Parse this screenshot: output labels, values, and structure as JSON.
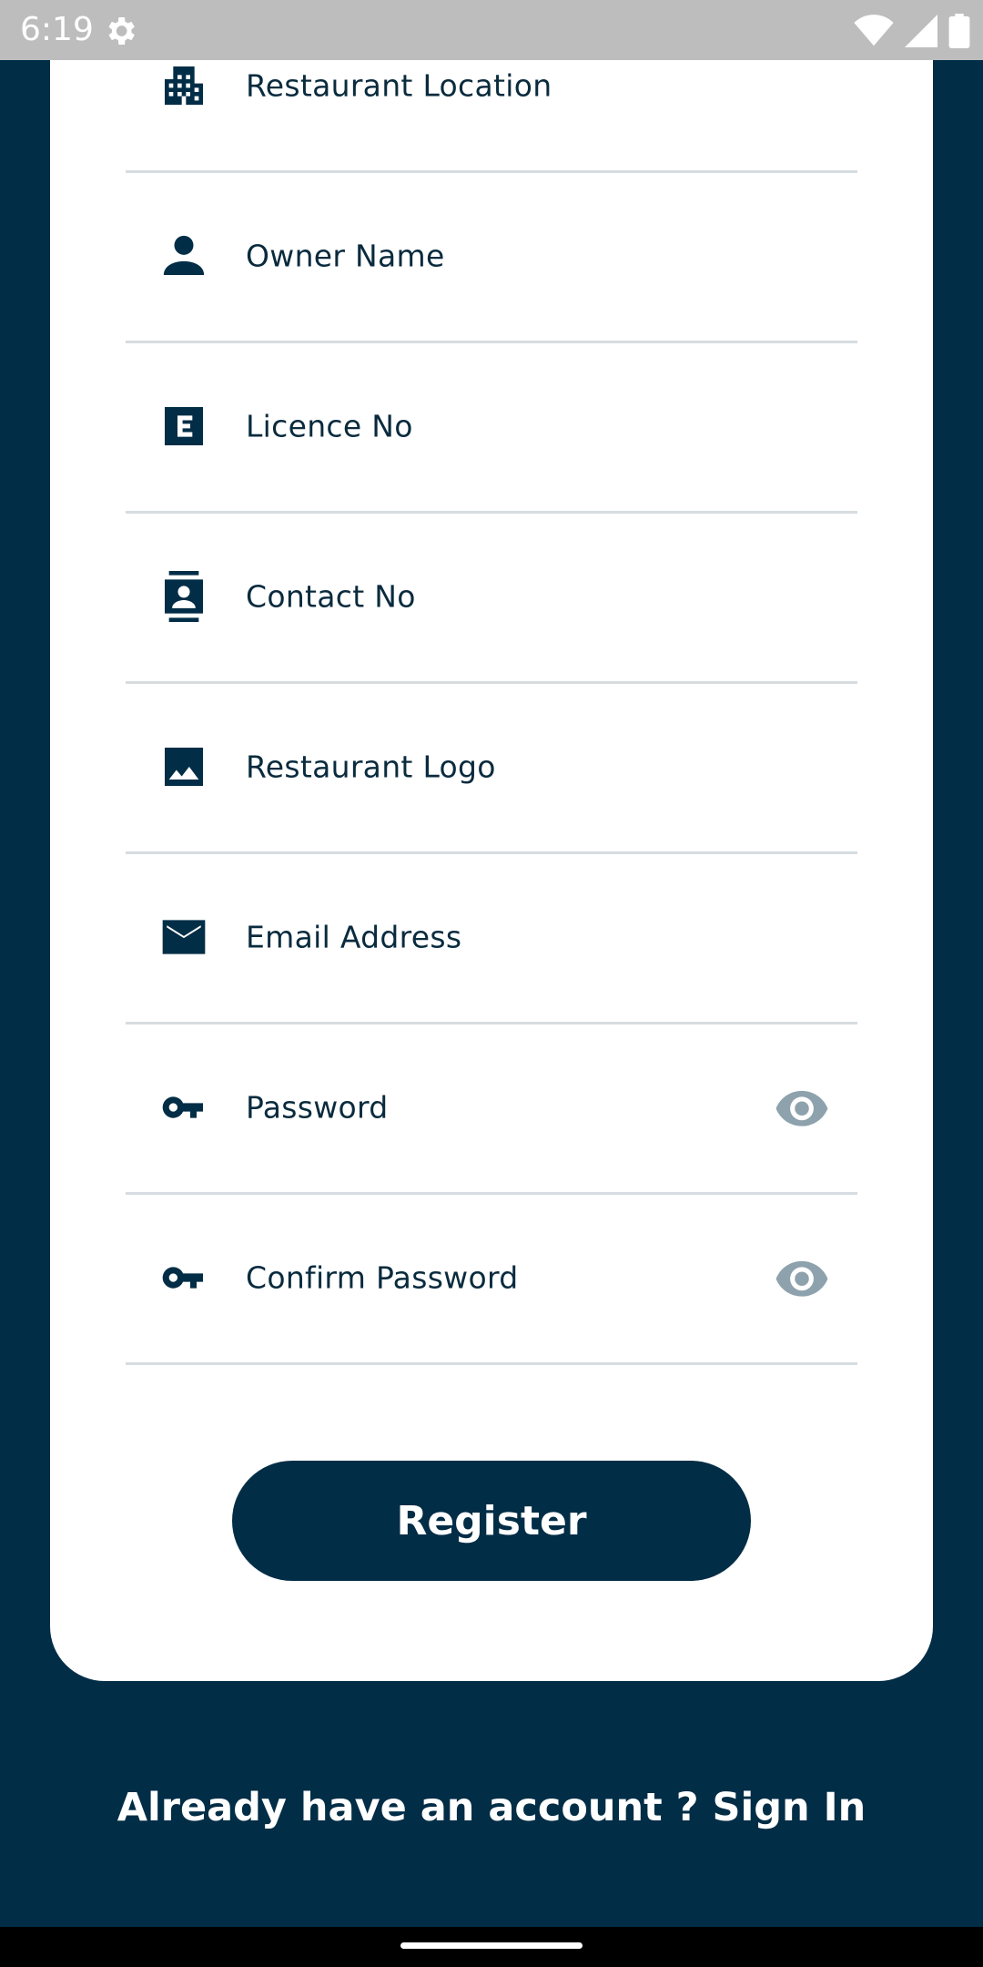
{
  "status_bar": {
    "time": "6:19"
  },
  "form": {
    "fields": [
      {
        "label": "Restaurant Location",
        "icon": "building-icon"
      },
      {
        "label": "Owner Name",
        "icon": "person-icon"
      },
      {
        "label": "Licence No",
        "icon": "license-badge-icon"
      },
      {
        "label": "Contact No",
        "icon": "contacts-icon"
      },
      {
        "label": "Restaurant Logo",
        "icon": "image-icon"
      },
      {
        "label": "Email Address",
        "icon": "mail-icon"
      },
      {
        "label": "Password",
        "icon": "key-icon",
        "toggle": "eye-icon"
      },
      {
        "label": "Confirm Password",
        "icon": "key-icon",
        "toggle": "eye-icon"
      }
    ],
    "register_label": "Register"
  },
  "footer": {
    "prompt": "Already have an account ?",
    "signin_label": "Sign In"
  },
  "colors": {
    "primary": "#022d46",
    "card": "#ffffff",
    "divider": "#d6dcdf",
    "icon_muted": "#8da2ad"
  }
}
